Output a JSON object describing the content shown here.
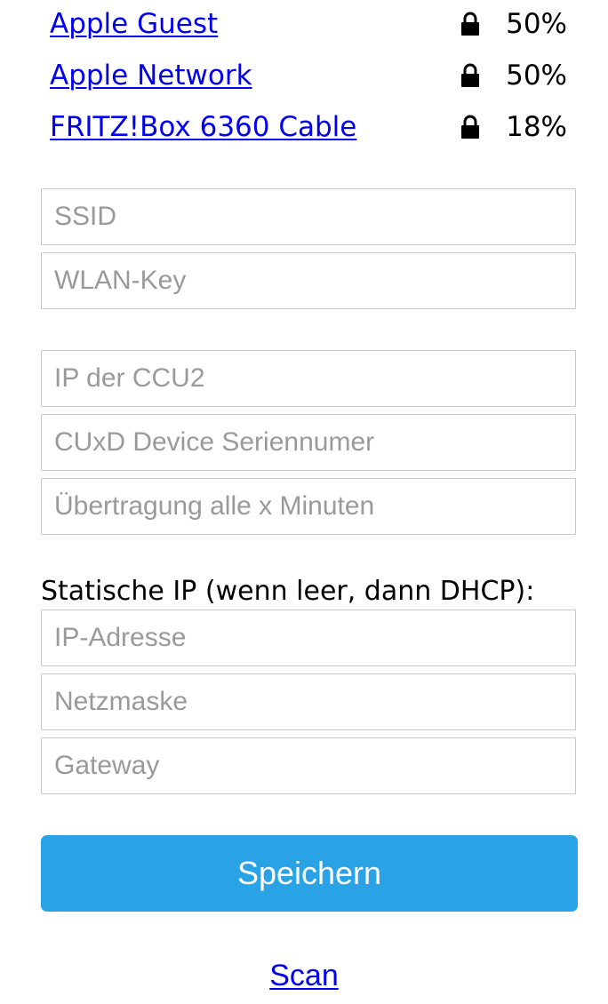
{
  "networks": [
    {
      "ssid": "Apple Guest",
      "secured": true,
      "quality": "50%"
    },
    {
      "ssid": "Apple Network",
      "secured": true,
      "quality": "50%"
    },
    {
      "ssid": "FRITZ!Box 6360 Cable",
      "secured": true,
      "quality": "18%"
    }
  ],
  "form": {
    "ssid_placeholder": "SSID",
    "wlan_key_placeholder": "WLAN-Key",
    "ccu_ip_placeholder": "IP der CCU2",
    "cuxd_serial_placeholder": "CUxD Device Seriennumer",
    "interval_placeholder": "Übertragung alle x Minuten",
    "static_ip_label": "Statische IP (wenn leer, dann DHCP):",
    "ip_address_placeholder": "IP-Adresse",
    "netmask_placeholder": "Netzmaske",
    "gateway_placeholder": "Gateway",
    "save_label": "Speichern"
  },
  "scan_label": "Scan",
  "colors": {
    "link": "#0000ee",
    "button": "#2aa3e6",
    "button_text": "#ffffff",
    "field_border": "#c8c8c8",
    "placeholder": "#9a9a9a"
  },
  "icons": {
    "secured": "lock-icon"
  }
}
